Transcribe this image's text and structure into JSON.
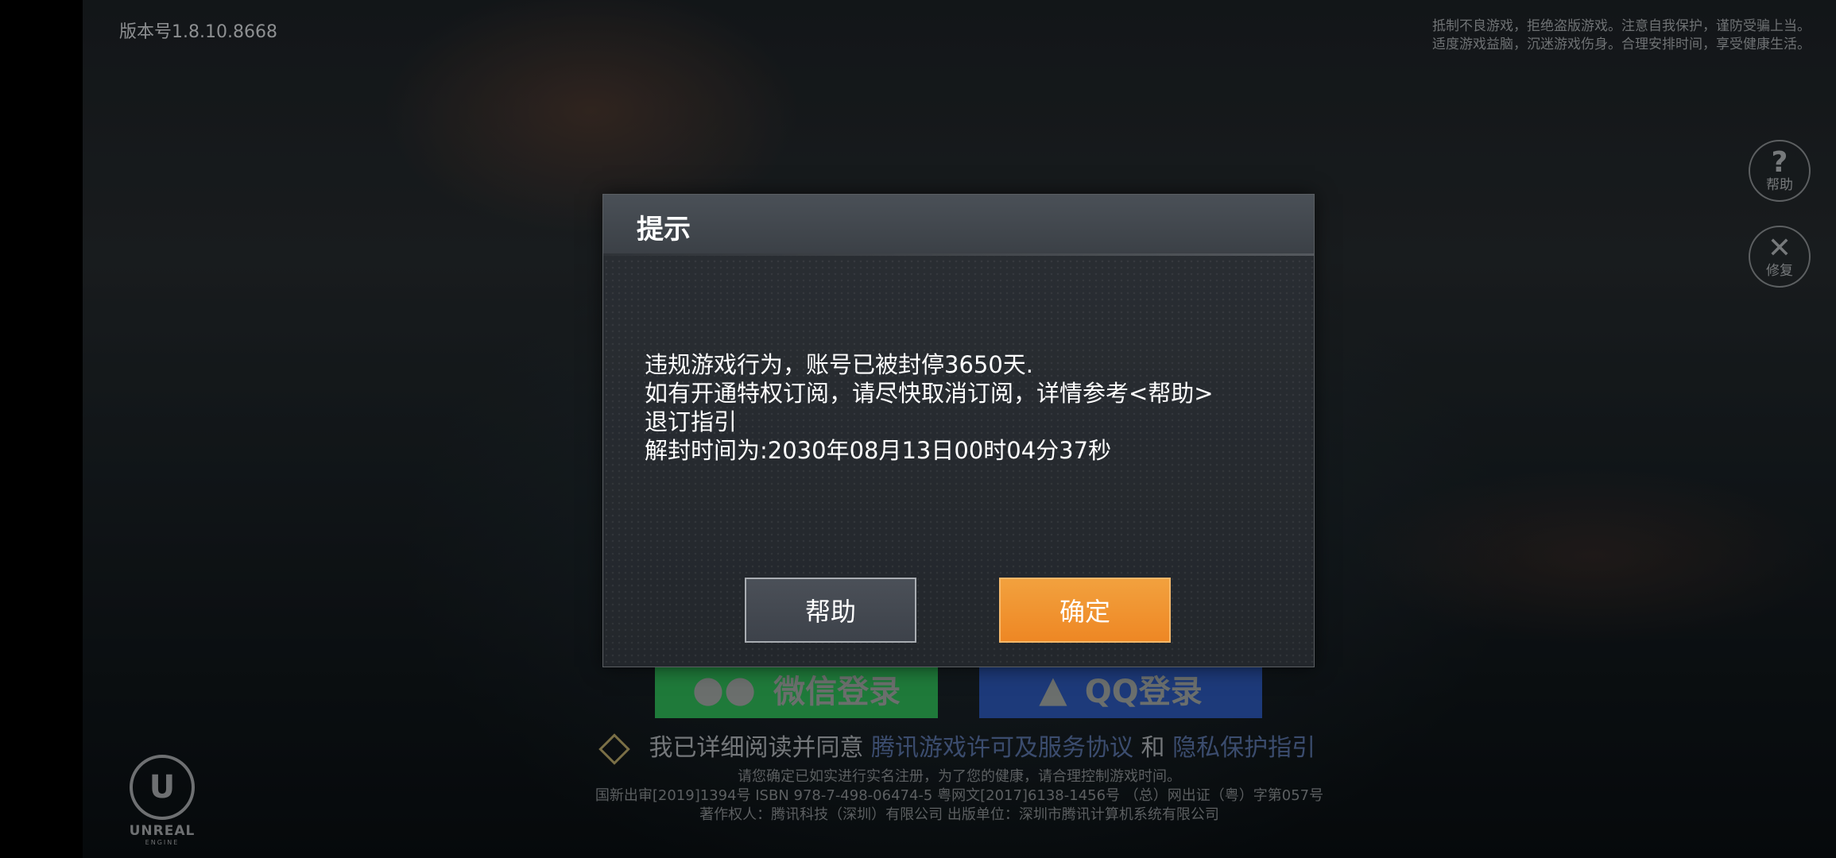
{
  "version_label": "版本号1.8.10.8668",
  "health_notice": {
    "line1": "抵制不良游戏，拒绝盗版游戏。注意自我保护，谨防受骗上当。",
    "line2": "适度游戏益脑，沉迷游戏伤身。合理安排时间，享受健康生活。"
  },
  "side_buttons": {
    "help": {
      "glyph": "?",
      "label": "帮助"
    },
    "repair": {
      "glyph": "✕",
      "label": "修复"
    }
  },
  "login": {
    "wechat_label": "微信登录",
    "qq_label": "QQ登录",
    "wechat_color": "#1f7a3a",
    "qq_color": "#1d3a7a"
  },
  "agreement": {
    "prefix": "我已详细阅读并同意",
    "link1": "腾讯游戏许可及服务协议",
    "middle": "和",
    "link2": "隐私保护指引"
  },
  "footer": {
    "line1": "请您确定已如实进行实名注册，为了您的健康，请合理控制游戏时间。",
    "line2": "国新出审[2019]1394号  ISBN 978-7-498-06474-5  粤网文[2017]6138-1456号 （总）网出证（粤）字第057号",
    "line3": "著作权人：腾讯科技（深圳）有限公司   出版单位：深圳市腾讯计算机系统有限公司"
  },
  "engine_logo": {
    "glyph": "U",
    "name": "UNREAL",
    "sub": "ENGINE"
  },
  "dialog": {
    "title": "提示",
    "lines": [
      "违规游戏行为，账号已被封停3650天.",
      "如有开通特权订阅，请尽快取消订阅，详情参考<帮助>",
      "退订指引",
      "解封时间为:2030年08月13日00时04分37秒"
    ],
    "help_button": "帮助",
    "ok_button": "确定",
    "accent_color": "#f0902c"
  }
}
